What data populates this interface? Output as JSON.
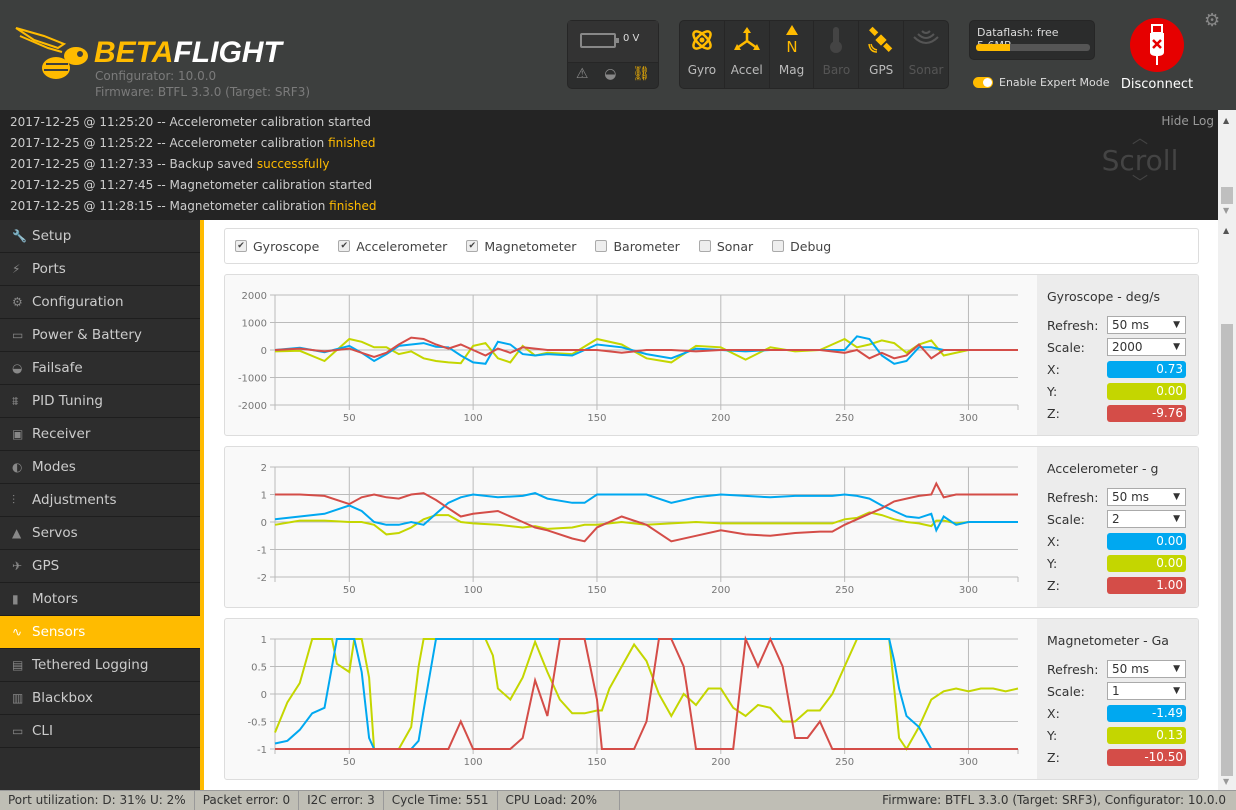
{
  "header": {
    "brand_part1": "BETA",
    "brand_part2": "FLIGHT",
    "configurator": "Configurator: 10.0.0",
    "firmware": "Firmware: BTFL 3.3.0 (Target: SRF3)",
    "battery_voltage": "0 V",
    "sensors": [
      {
        "label": "Gyro",
        "active": true
      },
      {
        "label": "Accel",
        "active": true
      },
      {
        "label": "Mag",
        "active": true
      },
      {
        "label": "Baro",
        "active": false
      },
      {
        "label": "GPS",
        "active": true
      },
      {
        "label": "Sonar",
        "active": false
      }
    ],
    "dataflash_label": "Dataflash: free 5.6MB",
    "dataflash_used_fraction": 0.3,
    "expert_mode_label": "Enable Expert Mode",
    "expert_mode_on": true,
    "disconnect_label": "Disconnect",
    "accent": "#ffbb00"
  },
  "log": {
    "hide_label": "Hide Log",
    "scroll_hint": "Scroll",
    "lines": [
      {
        "text": "2017-12-25 @ 11:25:20 -- Accelerometer calibration started",
        "highlight": ""
      },
      {
        "text": "2017-12-25 @ 11:25:22 -- Accelerometer calibration ",
        "highlight": "finished"
      },
      {
        "text": "2017-12-25 @ 11:27:33 -- Backup saved ",
        "highlight": "successfully"
      },
      {
        "text": "2017-12-25 @ 11:27:45 -- Magnetometer calibration started",
        "highlight": ""
      },
      {
        "text": "2017-12-25 @ 11:28:15 -- Magnetometer calibration ",
        "highlight": "finished"
      }
    ]
  },
  "sidebar": {
    "items": [
      {
        "label": "Setup",
        "icon": "wrench-icon",
        "glyph": "🔧"
      },
      {
        "label": "Ports",
        "icon": "plug-icon",
        "glyph": "⚡"
      },
      {
        "label": "Configuration",
        "icon": "gear-icon",
        "glyph": "⚙"
      },
      {
        "label": "Power & Battery",
        "icon": "battery-icon",
        "glyph": "▭"
      },
      {
        "label": "Failsafe",
        "icon": "parachute-icon",
        "glyph": "◒"
      },
      {
        "label": "PID Tuning",
        "icon": "hierarchy-icon",
        "glyph": "⩩"
      },
      {
        "label": "Receiver",
        "icon": "receiver-icon",
        "glyph": "▣"
      },
      {
        "label": "Modes",
        "icon": "toggle-icon",
        "glyph": "◐"
      },
      {
        "label": "Adjustments",
        "icon": "sliders-icon",
        "glyph": "⫶"
      },
      {
        "label": "Servos",
        "icon": "servo-icon",
        "glyph": "▲"
      },
      {
        "label": "GPS",
        "icon": "satellite-icon",
        "glyph": "✈"
      },
      {
        "label": "Motors",
        "icon": "motor-icon",
        "glyph": "▮"
      },
      {
        "label": "Sensors",
        "icon": "pulse-icon",
        "glyph": "∿",
        "active": true
      },
      {
        "label": "Tethered Logging",
        "icon": "logging-icon",
        "glyph": "▤"
      },
      {
        "label": "Blackbox",
        "icon": "blackbox-icon",
        "glyph": "▥"
      },
      {
        "label": "CLI",
        "icon": "terminal-icon",
        "glyph": "▭"
      }
    ]
  },
  "sensor_checks": [
    {
      "label": "Gyroscope",
      "checked": true
    },
    {
      "label": "Accelerometer",
      "checked": true
    },
    {
      "label": "Magnetometer",
      "checked": true
    },
    {
      "label": "Barometer",
      "checked": false
    },
    {
      "label": "Sonar",
      "checked": false
    },
    {
      "label": "Debug",
      "checked": false
    }
  ],
  "colors": {
    "x": "#00a8f0",
    "y": "#c4d600",
    "z": "#d44d48"
  },
  "panels": [
    {
      "title": "Gyroscope - deg/s",
      "refresh_label": "Refresh:",
      "refresh": "50 ms",
      "scale_label": "Scale:",
      "scale": "2000",
      "x": "0.73",
      "y": "0.00",
      "z": "-9.76"
    },
    {
      "title": "Accelerometer - g",
      "refresh_label": "Refresh:",
      "refresh": "50 ms",
      "scale_label": "Scale:",
      "scale": "2",
      "x": "0.00",
      "y": "0.00",
      "z": "1.00"
    },
    {
      "title": "Magnetometer - Ga",
      "refresh_label": "Refresh:",
      "refresh": "50 ms",
      "scale_label": "Scale:",
      "scale": "1",
      "x": "-1.49",
      "y": "0.13",
      "z": "-10.50"
    }
  ],
  "chart_data": [
    {
      "type": "line",
      "title": "Gyroscope - deg/s",
      "xlim": [
        20,
        320
      ],
      "ylim": [
        -2000,
        2000
      ],
      "xticks": [
        50,
        100,
        150,
        200,
        250,
        300
      ],
      "yticks": [
        2000,
        1000,
        0,
        -1000,
        -2000
      ],
      "x": [
        20,
        30,
        40,
        50,
        55,
        60,
        65,
        70,
        75,
        80,
        85,
        90,
        95,
        100,
        105,
        110,
        115,
        120,
        125,
        130,
        140,
        150,
        160,
        170,
        180,
        190,
        200,
        210,
        220,
        230,
        240,
        250,
        255,
        260,
        265,
        270,
        275,
        280,
        285,
        290,
        300,
        310,
        320
      ],
      "series": [
        {
          "name": "X",
          "values": [
            0,
            80,
            -80,
            150,
            -100,
            -400,
            -150,
            150,
            200,
            250,
            120,
            100,
            -200,
            -450,
            -500,
            300,
            200,
            -150,
            -200,
            -150,
            -200,
            200,
            100,
            -150,
            -300,
            50,
            0,
            -50,
            0,
            0,
            0,
            0,
            500,
            400,
            -200,
            -500,
            -400,
            100,
            100,
            0,
            0,
            0,
            0
          ]
        },
        {
          "name": "Y",
          "values": [
            -50,
            -30,
            -400,
            400,
            300,
            100,
            100,
            -150,
            -50,
            -300,
            -400,
            -450,
            -480,
            150,
            250,
            -300,
            -450,
            150,
            -200,
            -100,
            -150,
            400,
            200,
            -300,
            -450,
            150,
            100,
            -350,
            100,
            -50,
            0,
            400,
            100,
            200,
            350,
            250,
            -100,
            200,
            350,
            -200,
            0,
            0,
            0
          ]
        },
        {
          "name": "Z",
          "values": [
            0,
            50,
            -50,
            50,
            -100,
            -250,
            -100,
            200,
            450,
            400,
            200,
            50,
            200,
            0,
            -200,
            50,
            -100,
            100,
            50,
            0,
            0,
            0,
            -100,
            0,
            0,
            -50,
            0,
            0,
            0,
            0,
            0,
            -100,
            0,
            -300,
            -100,
            -300,
            -200,
            200,
            -300,
            0,
            0,
            0,
            0
          ]
        }
      ]
    },
    {
      "type": "line",
      "title": "Accelerometer - g",
      "xlim": [
        20,
        320
      ],
      "ylim": [
        -2,
        2
      ],
      "xticks": [
        50,
        100,
        150,
        200,
        250,
        300
      ],
      "yticks": [
        2,
        1,
        0,
        -1,
        -2
      ],
      "x": [
        20,
        30,
        40,
        50,
        55,
        60,
        65,
        70,
        75,
        80,
        85,
        90,
        95,
        100,
        110,
        120,
        125,
        130,
        140,
        145,
        150,
        160,
        170,
        180,
        190,
        200,
        210,
        220,
        230,
        240,
        245,
        250,
        255,
        260,
        265,
        270,
        275,
        280,
        285,
        287,
        290,
        295,
        300,
        310,
        320
      ],
      "series": [
        {
          "name": "X",
          "values": [
            0.1,
            0.2,
            0.3,
            0.6,
            0.4,
            0.0,
            -0.1,
            -0.1,
            0.0,
            -0.1,
            0.3,
            0.7,
            0.9,
            1.0,
            0.9,
            0.95,
            1.05,
            0.85,
            0.7,
            0.7,
            1.0,
            1.0,
            1.0,
            0.7,
            0.9,
            1.0,
            0.95,
            0.9,
            0.95,
            0.95,
            0.95,
            1.0,
            0.95,
            0.85,
            0.6,
            0.4,
            0.2,
            0.15,
            0.3,
            -0.3,
            0.2,
            -0.1,
            0.0,
            0.0,
            0.0
          ]
        },
        {
          "name": "Y",
          "values": [
            -0.1,
            0.05,
            0.05,
            0.0,
            0.0,
            -0.1,
            -0.45,
            -0.4,
            -0.2,
            0.1,
            0.25,
            0.25,
            0.0,
            -0.05,
            -0.1,
            -0.2,
            -0.15,
            -0.25,
            -0.2,
            -0.1,
            -0.1,
            0.0,
            -0.1,
            -0.05,
            0.0,
            -0.05,
            -0.05,
            -0.05,
            -0.05,
            -0.05,
            -0.05,
            0.1,
            0.15,
            0.35,
            0.25,
            0.1,
            0.0,
            -0.05,
            -0.15,
            0.05,
            0.05,
            -0.05,
            0.0,
            0.0,
            0.0
          ]
        },
        {
          "name": "Z",
          "values": [
            1.0,
            1.0,
            0.95,
            0.65,
            0.9,
            1.0,
            0.9,
            0.85,
            1.0,
            1.05,
            0.8,
            0.5,
            0.2,
            0.3,
            0.4,
            0.0,
            -0.2,
            -0.3,
            -0.6,
            -0.7,
            -0.2,
            0.2,
            -0.1,
            -0.7,
            -0.5,
            -0.3,
            -0.45,
            -0.5,
            -0.4,
            -0.35,
            -0.35,
            -0.1,
            0.1,
            0.3,
            0.5,
            0.75,
            0.85,
            0.95,
            1.0,
            1.4,
            0.9,
            1.0,
            1.0,
            1.0,
            1.0
          ]
        }
      ]
    },
    {
      "type": "line",
      "title": "Magnetometer - Ga",
      "xlim": [
        20,
        320
      ],
      "ylim": [
        -1,
        1
      ],
      "xticks": [
        50,
        100,
        150,
        200,
        250,
        300
      ],
      "yticks": [
        1,
        0.5,
        0,
        -0.5,
        -1
      ],
      "x": [
        20,
        25,
        30,
        35,
        40,
        43,
        45,
        50,
        52,
        55,
        58,
        60,
        62,
        65,
        70,
        75,
        78,
        80,
        85,
        90,
        95,
        100,
        105,
        108,
        110,
        115,
        120,
        125,
        130,
        135,
        140,
        145,
        150,
        152,
        155,
        160,
        165,
        170,
        175,
        180,
        185,
        190,
        195,
        200,
        205,
        210,
        215,
        220,
        225,
        230,
        235,
        240,
        245,
        250,
        255,
        260,
        265,
        268,
        270,
        272,
        275,
        280,
        285,
        290,
        295,
        300,
        305,
        310,
        315,
        320
      ],
      "series": [
        {
          "name": "X",
          "values": [
            -0.9,
            -0.85,
            -0.65,
            -0.35,
            -0.25,
            0.5,
            1,
            1,
            1,
            0.4,
            -0.8,
            -1,
            -1,
            -1,
            -1,
            -1,
            -0.85,
            -0.3,
            1,
            1,
            1,
            1,
            1,
            1,
            1,
            1,
            1,
            1,
            1,
            1,
            1,
            1,
            1,
            1,
            1,
            1,
            1,
            1,
            1,
            1,
            1,
            1,
            1,
            1,
            1,
            1,
            1,
            1,
            1,
            1,
            1,
            1,
            1,
            1,
            1,
            1,
            1,
            1,
            0.6,
            0.1,
            -0.4,
            -0.6,
            -1,
            -1,
            -1,
            -1,
            -1,
            -1,
            -1,
            -1
          ]
        },
        {
          "name": "Y",
          "values": [
            -0.7,
            -0.15,
            0.2,
            1,
            1,
            1,
            0.55,
            0.4,
            1,
            1,
            0.3,
            -1,
            -1,
            -1,
            -1,
            -0.6,
            0.5,
            1,
            1,
            1,
            1,
            1,
            1,
            0.7,
            0.1,
            -0.1,
            0.3,
            0.95,
            0.4,
            -0.1,
            -0.35,
            -0.35,
            -0.3,
            -0.3,
            0.1,
            0.5,
            0.9,
            0.6,
            0.0,
            -0.4,
            0.0,
            -0.2,
            0.1,
            0.1,
            -0.25,
            -0.4,
            -0.2,
            -0.25,
            -0.5,
            -0.5,
            -0.3,
            -0.3,
            0.0,
            0.5,
            1,
            1,
            1,
            1,
            0.1,
            -0.8,
            -1,
            -0.6,
            -0.1,
            0.05,
            0.1,
            0.05,
            0.1,
            0.1,
            0.05,
            0.1
          ]
        },
        {
          "name": "Z",
          "values": [
            -1,
            -1,
            -1,
            -1,
            -1,
            -1,
            -1,
            -1,
            -1,
            -1,
            -1,
            -1,
            -1,
            -1,
            -1,
            -1,
            -1,
            -1,
            -1,
            -1,
            -0.5,
            -1,
            -1,
            -1,
            -1,
            -1,
            -0.8,
            0.25,
            -0.4,
            1,
            1,
            1,
            -0.1,
            -1,
            -1,
            -1,
            -1,
            -0.5,
            1,
            1,
            0.5,
            -1,
            -1,
            -1,
            -1,
            1,
            0.5,
            1,
            0.5,
            -0.8,
            -0.8,
            -0.5,
            -1,
            -1,
            -1,
            -1,
            -1,
            -1,
            -1,
            -1,
            -1,
            -1,
            -1,
            -1,
            -1,
            -1,
            -1,
            -1,
            -1,
            -1
          ]
        }
      ]
    }
  ],
  "statusbar": {
    "port_util": "Port utilization: D: 31% U: 2%",
    "packet_error": "Packet error: 0",
    "i2c_error": "I2C error: 3",
    "cycle_time": "Cycle Time: 551",
    "cpu_load": "CPU Load: 20%",
    "right": "Firmware: BTFL 3.3.0 (Target: SRF3), Configurator: 10.0.0"
  }
}
